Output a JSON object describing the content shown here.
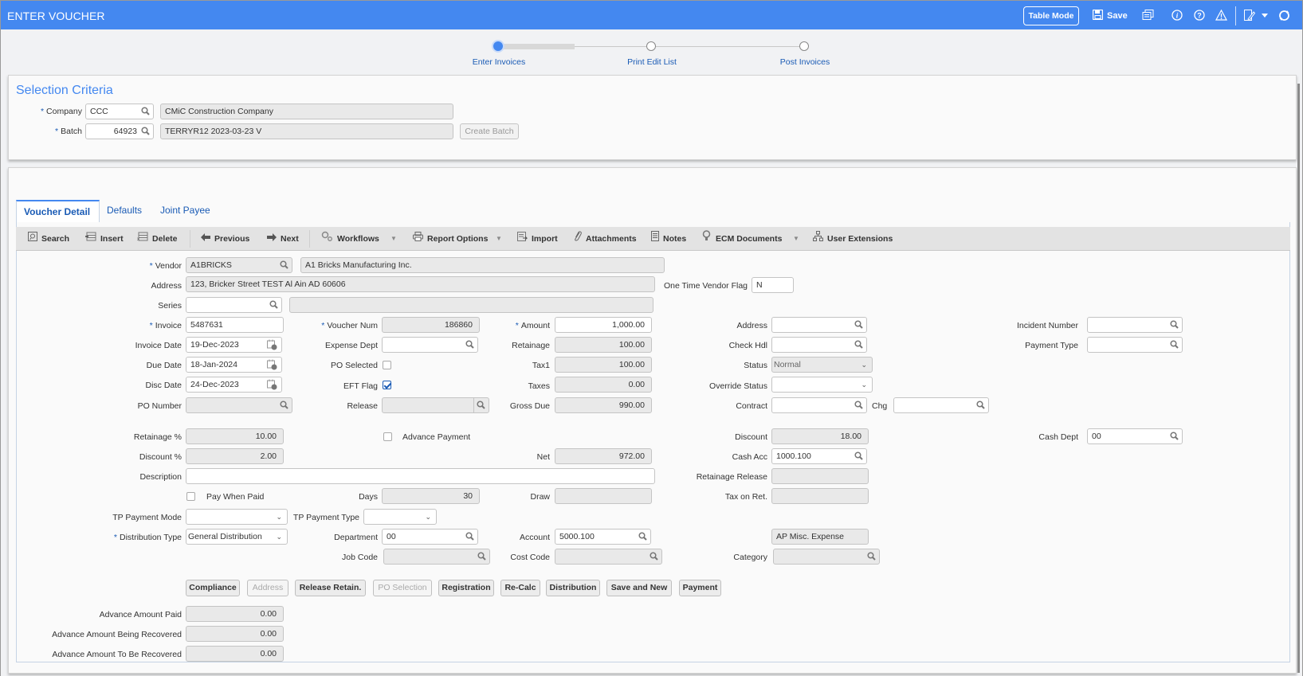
{
  "header": {
    "title": "ENTER VOUCHER",
    "table_mode_label": "Table Mode",
    "save_label": "Save",
    "icons": [
      "save-icon",
      "copy-icon",
      "info-icon",
      "help-icon",
      "warning-icon",
      "edit-icon",
      "dropdown-icon",
      "refresh-icon"
    ],
    "accent_color": "#4488f0"
  },
  "stepper": {
    "steps": [
      {
        "label": "Enter Invoices",
        "state": "active"
      },
      {
        "label": "Print Edit List",
        "state": "pending"
      },
      {
        "label": "Post Invoices",
        "state": "pending"
      }
    ]
  },
  "selection": {
    "title": "Selection Criteria",
    "company": {
      "label": "Company",
      "value": "CCC",
      "name": "CMiC Construction Company"
    },
    "batch": {
      "label": "Batch",
      "value": "64923",
      "name": "TERRYR12 2023-03-23 V"
    },
    "create_batch_label": "Create Batch"
  },
  "tabs": [
    {
      "label": "Voucher Detail",
      "active": true
    },
    {
      "label": "Defaults",
      "active": false
    },
    {
      "label": "Joint Payee",
      "active": false
    }
  ],
  "toolbar": {
    "search": "Search",
    "insert": "Insert",
    "delete": "Delete",
    "previous": "Previous",
    "next": "Next",
    "workflows": "Workflows",
    "report_options": "Report Options",
    "import": "Import",
    "attachments": "Attachments",
    "notes": "Notes",
    "ecm_documents": "ECM Documents",
    "user_extensions": "User Extensions"
  },
  "form": {
    "vendor": {
      "label": "Vendor",
      "value": "A1BRICKS",
      "name": "A1 Bricks Manufacturing Inc."
    },
    "address": {
      "label": "Address",
      "value": "123, Bricker Street TEST  Al Ain AD 60606"
    },
    "one_time_vendor_flag": {
      "label": "One Time Vendor Flag",
      "value": "N"
    },
    "series": {
      "label": "Series",
      "value": "",
      "desc": ""
    },
    "invoice": {
      "label": "Invoice",
      "value": "5487631"
    },
    "invoice_date": {
      "label": "Invoice Date",
      "value": "19-Dec-2023"
    },
    "due_date": {
      "label": "Due Date",
      "value": "18-Jan-2024"
    },
    "disc_date": {
      "label": "Disc Date",
      "value": "24-Dec-2023"
    },
    "po_number": {
      "label": "PO Number",
      "value": ""
    },
    "voucher_num": {
      "label": "Voucher Num",
      "value": "186860"
    },
    "expense_dept": {
      "label": "Expense Dept",
      "value": ""
    },
    "po_selected": {
      "label": "PO Selected",
      "checked": false
    },
    "eft_flag": {
      "label": "EFT Flag",
      "checked": true
    },
    "release": {
      "label": "Release",
      "value": ""
    },
    "amount": {
      "label": "Amount",
      "value": "1,000.00"
    },
    "retainage": {
      "label": "Retainage",
      "value": "100.00"
    },
    "tax1": {
      "label": "Tax1",
      "value": "100.00"
    },
    "taxes": {
      "label": "Taxes",
      "value": "0.00"
    },
    "gross_due": {
      "label": "Gross Due",
      "value": "990.00"
    },
    "address2": {
      "label": "Address",
      "value": ""
    },
    "check_hdl": {
      "label": "Check Hdl",
      "value": ""
    },
    "status": {
      "label": "Status",
      "value": "Normal"
    },
    "override_status": {
      "label": "Override Status",
      "value": ""
    },
    "contract": {
      "label": "Contract",
      "value": ""
    },
    "chg": {
      "label": "Chg",
      "value": ""
    },
    "incident_number": {
      "label": "Incident Number",
      "value": ""
    },
    "payment_type": {
      "label": "Payment Type",
      "value": ""
    },
    "retainage_pct": {
      "label": "Retainage %",
      "value": "10.00"
    },
    "discount_pct": {
      "label": "Discount %",
      "value": "2.00"
    },
    "advance_payment": {
      "label": "Advance Payment",
      "checked": false
    },
    "net": {
      "label": "Net",
      "value": "972.00"
    },
    "discount": {
      "label": "Discount",
      "value": "18.00"
    },
    "cash_acc": {
      "label": "Cash Acc",
      "value": "1000.100"
    },
    "retainage_release": {
      "label": "Retainage Release",
      "value": ""
    },
    "tax_on_ret": {
      "label": "Tax on Ret.",
      "value": ""
    },
    "cash_dept": {
      "label": "Cash Dept",
      "value": "00"
    },
    "description": {
      "label": "Description",
      "value": ""
    },
    "pay_when_paid": {
      "label": "Pay When Paid",
      "checked": false
    },
    "days": {
      "label": "Days",
      "value": "30"
    },
    "draw": {
      "label": "Draw",
      "value": ""
    },
    "tp_payment_mode": {
      "label": "TP Payment Mode",
      "value": ""
    },
    "tp_payment_type": {
      "label": "TP Payment Type",
      "value": ""
    },
    "distribution_type": {
      "label": "Distribution Type",
      "value": "General Distribution"
    },
    "department": {
      "label": "Department",
      "value": "00"
    },
    "account": {
      "label": "Account",
      "value": "5000.100",
      "desc": "AP Misc. Expense"
    },
    "job_code": {
      "label": "Job Code",
      "value": ""
    },
    "cost_code": {
      "label": "Cost Code",
      "value": ""
    },
    "category": {
      "label": "Category",
      "value": ""
    },
    "advance_amount_paid": {
      "label": "Advance Amount Paid",
      "value": "0.00"
    },
    "advance_amount_being_recovered": {
      "label": "Advance Amount Being Recovered",
      "value": "0.00"
    },
    "advance_amount_to_be_recovered": {
      "label": "Advance Amount To Be Recovered",
      "value": "0.00"
    }
  },
  "actions": [
    {
      "label": "Compliance",
      "enabled": true
    },
    {
      "label": "Address",
      "enabled": false
    },
    {
      "label": "Release Retain.",
      "enabled": true
    },
    {
      "label": "PO Selection",
      "enabled": false
    },
    {
      "label": "Registration",
      "enabled": true
    },
    {
      "label": "Re-Calc",
      "enabled": true
    },
    {
      "label": "Distribution",
      "enabled": true
    },
    {
      "label": "Save and New",
      "enabled": true
    },
    {
      "label": "Payment",
      "enabled": true
    }
  ]
}
